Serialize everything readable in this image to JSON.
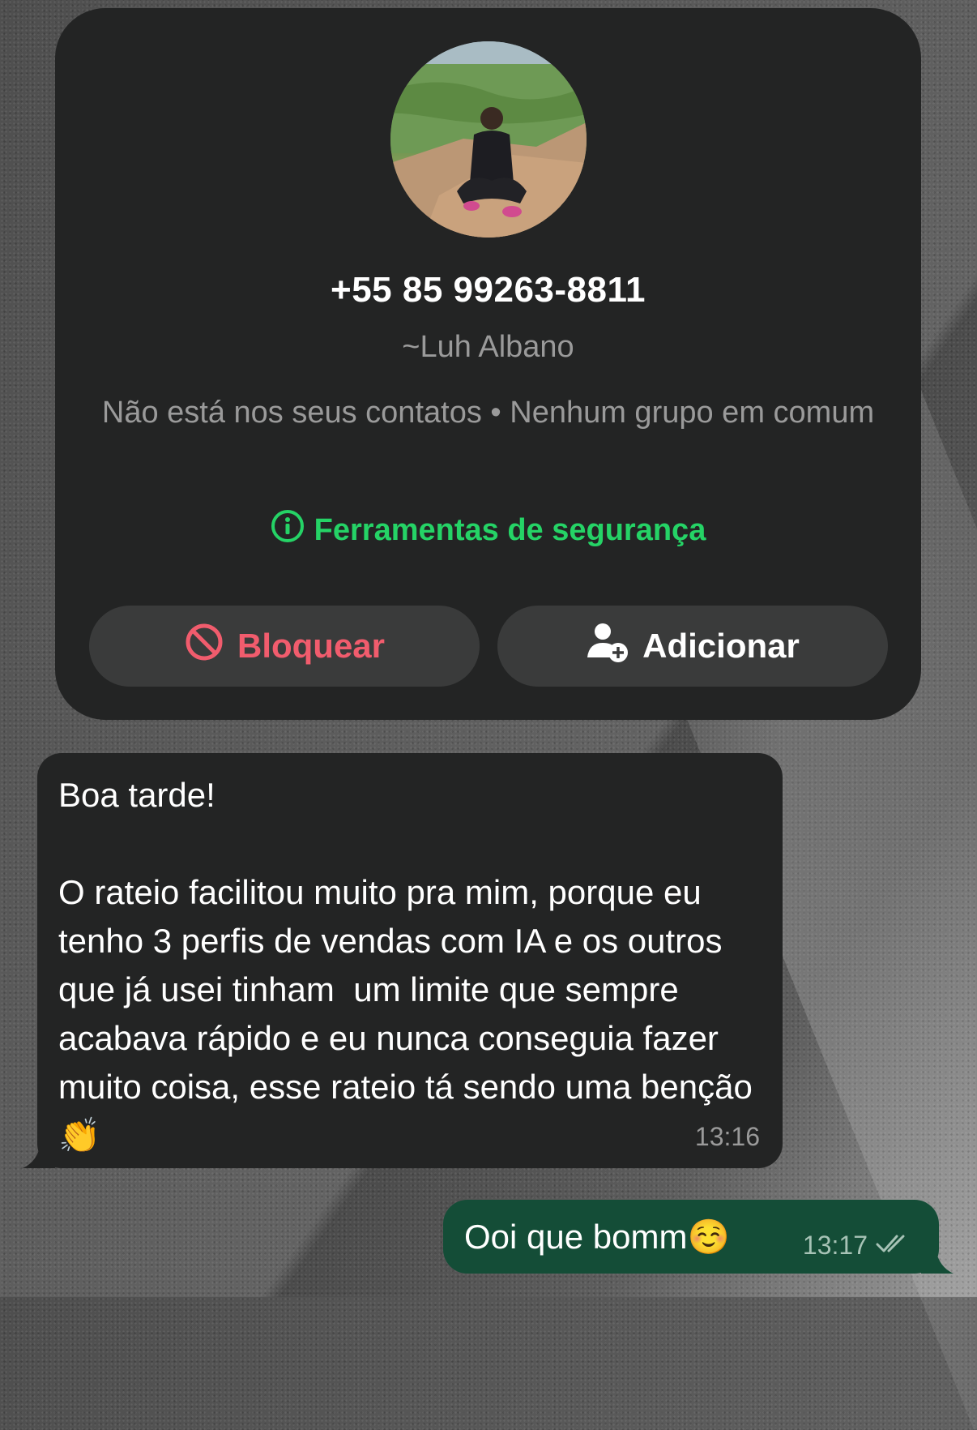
{
  "contact": {
    "phone": "+55 85 99263-8811",
    "display_name": "~Luh Albano",
    "info": "Não está nos seus contatos • Nenhum grupo em comum",
    "safety_tools_label": "Ferramentas de segurança",
    "block_label": "Bloquear",
    "add_label": "Adicionar"
  },
  "messages": [
    {
      "direction": "incoming",
      "text": "Boa tarde!\n\nO rateio facilitou muito pra mim, porque eu tenho 3 perfis de vendas com IA e os outros que já usei tinham  um limite que sempre acabava rápido e eu nunca conseguia fazer muito coisa, esse rateio tá sendo uma benção 👏",
      "time": "13:16"
    },
    {
      "direction": "outgoing",
      "text": "Ooi que bomm☺️",
      "time": "13:17",
      "status_icon": "double-check-icon"
    }
  ],
  "colors": {
    "card_background": "#232424",
    "incoming_bubble": "#232424",
    "outgoing_bubble": "#144d37",
    "safety_green": "#25d366",
    "block_red": "#f15c6d",
    "muted_text": "#9a9a9a"
  }
}
